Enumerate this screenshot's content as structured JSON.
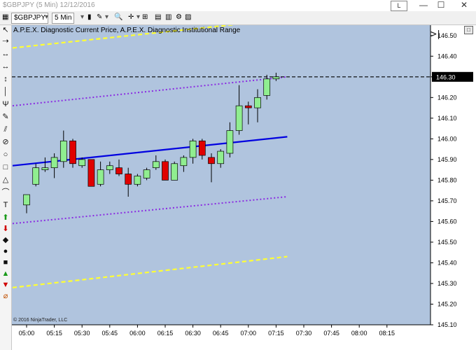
{
  "window": {
    "title": "$GBPJPY (5 Min)  12/12/2016",
    "link_label": "L",
    "minimize": "—",
    "maximize": "☐",
    "close": "✕"
  },
  "toolbar": {
    "instrument": "$GBPJPY",
    "interval": "5 Min"
  },
  "chart": {
    "indicator_label": "A.P.E.X. Diagnostic Current Price, A.P.E.X. Diagnostic Institutional Range",
    "copyright": "© 2016 NinjaTrader, LLC",
    "background": "#b0c4de",
    "current_price_label": "146.30"
  },
  "chart_data": {
    "type": "candlestick",
    "x_labels": [
      "05:00",
      "05:15",
      "05:30",
      "05:45",
      "06:00",
      "06:15",
      "06:30",
      "06:45",
      "07:00",
      "07:15",
      "07:30",
      "07:45",
      "08:00",
      "08:15"
    ],
    "y_ticks": [
      "146.50",
      "146.40",
      "146.30",
      "146.20",
      "146.10",
      "146.00",
      "145.90",
      "145.80",
      "145.70",
      "145.60",
      "145.50",
      "145.40",
      "145.30",
      "145.20",
      "145.10"
    ],
    "ylim": [
      145.1,
      146.55
    ],
    "candles": [
      {
        "i": 0,
        "o": 145.68,
        "h": 145.73,
        "l": 145.64,
        "c": 145.73,
        "dir": "up"
      },
      {
        "i": 1,
        "o": 145.78,
        "h": 145.88,
        "l": 145.77,
        "c": 145.86,
        "dir": "up"
      },
      {
        "i": 2,
        "o": 145.85,
        "h": 145.91,
        "l": 145.84,
        "c": 145.86,
        "dir": "up"
      },
      {
        "i": 3,
        "o": 145.86,
        "h": 145.93,
        "l": 145.81,
        "c": 145.91,
        "dir": "up"
      },
      {
        "i": 4,
        "o": 145.89,
        "h": 146.04,
        "l": 145.86,
        "c": 145.99,
        "dir": "up"
      },
      {
        "i": 5,
        "o": 145.99,
        "h": 146.0,
        "l": 145.86,
        "c": 145.88,
        "dir": "down"
      },
      {
        "i": 6,
        "o": 145.87,
        "h": 145.91,
        "l": 145.86,
        "c": 145.9,
        "dir": "up"
      },
      {
        "i": 7,
        "o": 145.9,
        "h": 145.9,
        "l": 145.78,
        "c": 145.77,
        "dir": "down"
      },
      {
        "i": 8,
        "o": 145.78,
        "h": 145.89,
        "l": 145.77,
        "c": 145.85,
        "dir": "up"
      },
      {
        "i": 9,
        "o": 145.85,
        "h": 145.89,
        "l": 145.83,
        "c": 145.87,
        "dir": "up"
      },
      {
        "i": 10,
        "o": 145.86,
        "h": 145.9,
        "l": 145.82,
        "c": 145.83,
        "dir": "down"
      },
      {
        "i": 11,
        "o": 145.83,
        "h": 145.86,
        "l": 145.72,
        "c": 145.78,
        "dir": "down"
      },
      {
        "i": 12,
        "o": 145.78,
        "h": 145.83,
        "l": 145.77,
        "c": 145.82,
        "dir": "up"
      },
      {
        "i": 13,
        "o": 145.81,
        "h": 145.86,
        "l": 145.8,
        "c": 145.85,
        "dir": "up"
      },
      {
        "i": 14,
        "o": 145.86,
        "h": 145.92,
        "l": 145.85,
        "c": 145.89,
        "dir": "up"
      },
      {
        "i": 15,
        "o": 145.89,
        "h": 145.9,
        "l": 145.8,
        "c": 145.8,
        "dir": "down"
      },
      {
        "i": 16,
        "o": 145.8,
        "h": 145.89,
        "l": 145.8,
        "c": 145.88,
        "dir": "up"
      },
      {
        "i": 17,
        "o": 145.87,
        "h": 145.92,
        "l": 145.84,
        "c": 145.91,
        "dir": "up"
      },
      {
        "i": 18,
        "o": 145.91,
        "h": 146.0,
        "l": 145.88,
        "c": 145.99,
        "dir": "up"
      },
      {
        "i": 19,
        "o": 145.99,
        "h": 146.0,
        "l": 145.9,
        "c": 145.92,
        "dir": "down"
      },
      {
        "i": 20,
        "o": 145.91,
        "h": 145.93,
        "l": 145.79,
        "c": 145.88,
        "dir": "down"
      },
      {
        "i": 21,
        "o": 145.88,
        "h": 145.95,
        "l": 145.86,
        "c": 145.94,
        "dir": "up"
      },
      {
        "i": 22,
        "o": 145.93,
        "h": 146.08,
        "l": 145.91,
        "c": 146.04,
        "dir": "up"
      },
      {
        "i": 23,
        "o": 146.04,
        "h": 146.26,
        "l": 146.02,
        "c": 146.16,
        "dir": "up"
      },
      {
        "i": 24,
        "o": 146.16,
        "h": 146.18,
        "l": 146.07,
        "c": 146.15,
        "dir": "down"
      },
      {
        "i": 25,
        "o": 146.15,
        "h": 146.24,
        "l": 146.08,
        "c": 146.2,
        "dir": "up"
      },
      {
        "i": 26,
        "o": 146.21,
        "h": 146.31,
        "l": 146.19,
        "c": 146.29,
        "dir": "up"
      },
      {
        "i": 27,
        "o": 146.29,
        "h": 146.32,
        "l": 146.28,
        "c": 146.3,
        "dir": "up"
      }
    ],
    "lines": [
      {
        "name": "regression",
        "color": "#0000e0",
        "from": [
          0,
          145.87
        ],
        "to": [
          27,
          146.01
        ],
        "style": "solid"
      },
      {
        "name": "upper-purple",
        "color": "#8a2be2",
        "from": [
          0,
          146.16
        ],
        "to": [
          27,
          146.3
        ],
        "style": "dotted"
      },
      {
        "name": "lower-purple",
        "color": "#8a2be2",
        "from": [
          0,
          145.59
        ],
        "to": [
          27,
          145.72
        ],
        "style": "dotted"
      },
      {
        "name": "upper-yellow",
        "color": "#ffff33",
        "from": [
          0,
          146.44
        ],
        "to": [
          27,
          146.58
        ],
        "style": "dashed"
      },
      {
        "name": "lower-yellow",
        "color": "#ffff33",
        "from": [
          0,
          145.28
        ],
        "to": [
          27,
          145.43
        ],
        "style": "dashed"
      }
    ],
    "current_price": 146.3,
    "grid": false,
    "colors": {
      "up": "#90ee90",
      "down": "#e00000",
      "background": "#b0c4de"
    }
  }
}
